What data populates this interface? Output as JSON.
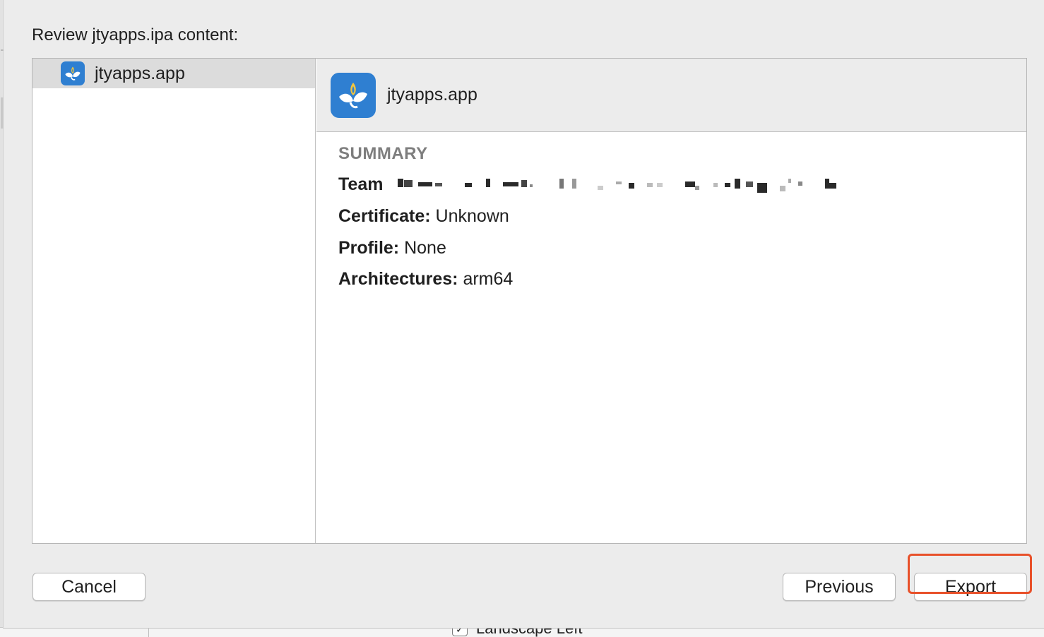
{
  "dialog": {
    "heading": "Review jtyapps.ipa content:"
  },
  "sidebar": {
    "items": [
      {
        "label": "jtyapps.app",
        "icon": "app-leaf-icon",
        "selected": true
      }
    ]
  },
  "detail": {
    "title": "jtyapps.app",
    "icon": "app-leaf-icon",
    "summary_heading": "SUMMARY",
    "fields": {
      "team": {
        "key": "Team",
        "value_redacted": true
      },
      "certificate": {
        "key": "Certificate:",
        "value": "Unknown"
      },
      "profile": {
        "key": "Profile:",
        "value": "None"
      },
      "architectures": {
        "key": "Architectures:",
        "value": "arm64"
      }
    }
  },
  "buttons": {
    "cancel": "Cancel",
    "previous": "Previous",
    "export": "Export"
  },
  "background_window": {
    "checkbox_label": "Landscape Left",
    "checkbox_checked": true
  },
  "colors": {
    "app_icon_blue": "#2f7fd1",
    "highlight": "#e8512a",
    "summary_gray": "#7e7e7e"
  }
}
